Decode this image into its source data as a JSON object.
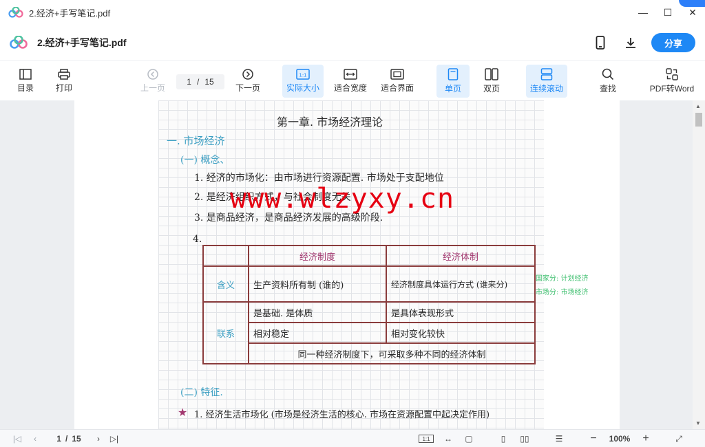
{
  "window": {
    "title": "2.经济+手写笔记.pdf",
    "controls": [
      "—",
      "☐",
      "✕"
    ]
  },
  "header": {
    "doc_name": "2.经济+手写笔记.pdf",
    "share_label": "分享"
  },
  "toolbar": {
    "toc": "目录",
    "print": "打印",
    "prev": "上一页",
    "page_current": "1",
    "page_sep": "/",
    "page_total": "15",
    "next": "下一页",
    "actual_size": "实际大小",
    "actual_size_icon": "1:1",
    "fit_width": "适合宽度",
    "fit_screen": "适合界面",
    "single": "单页",
    "double": "双页",
    "continuous": "连续滚动",
    "search": "查找",
    "pdf_to_word": "PDF转Word"
  },
  "note": {
    "chapter": "第一章. 市场经济理论",
    "h1": "一. 市场经济",
    "h2": "(一) 概念、",
    "l1": "1. 经济的市场化：由市场进行资源配置. 市场处于支配地位",
    "l2": "2. 是经济组织方式，与社会制度无关",
    "l3": "3. 是商品经济，是商品经济发展的高级阶段.",
    "l4": "4.",
    "t_h1": "经济制度",
    "t_h2": "经济体制",
    "t_r1c0": "含义",
    "t_r1c1": "生产资料所有制 (谁的)",
    "t_r1c2": "经济制度具体运行方式 (谁来分)",
    "t_r1c3a": "国家分: 计划经济",
    "t_r1c3b": "市场分: 市场经济",
    "t_r2c0": "联系",
    "t_r2c1": "是基础. 是体质",
    "t_r2c2": "是具体表现形式",
    "t_r3c1": "相对稳定",
    "t_r3c2": "相对变化较快",
    "t_r4": "同一种经济制度下，可采取多种不同的经济体制",
    "h3": "(二) 特征.",
    "l5": "1. 经济生活市场化 (市场是经济生活的核心. 市场在资源配置中起决定作用)"
  },
  "watermark": "www.wlzyxy.cn",
  "status": {
    "page_current": "1",
    "page_sep": "/",
    "page_total": "15",
    "zoom": "100%"
  },
  "colors": {
    "accent": "#1e88f5",
    "active_bg": "#e3f0fd",
    "watermark": "#e60012"
  }
}
